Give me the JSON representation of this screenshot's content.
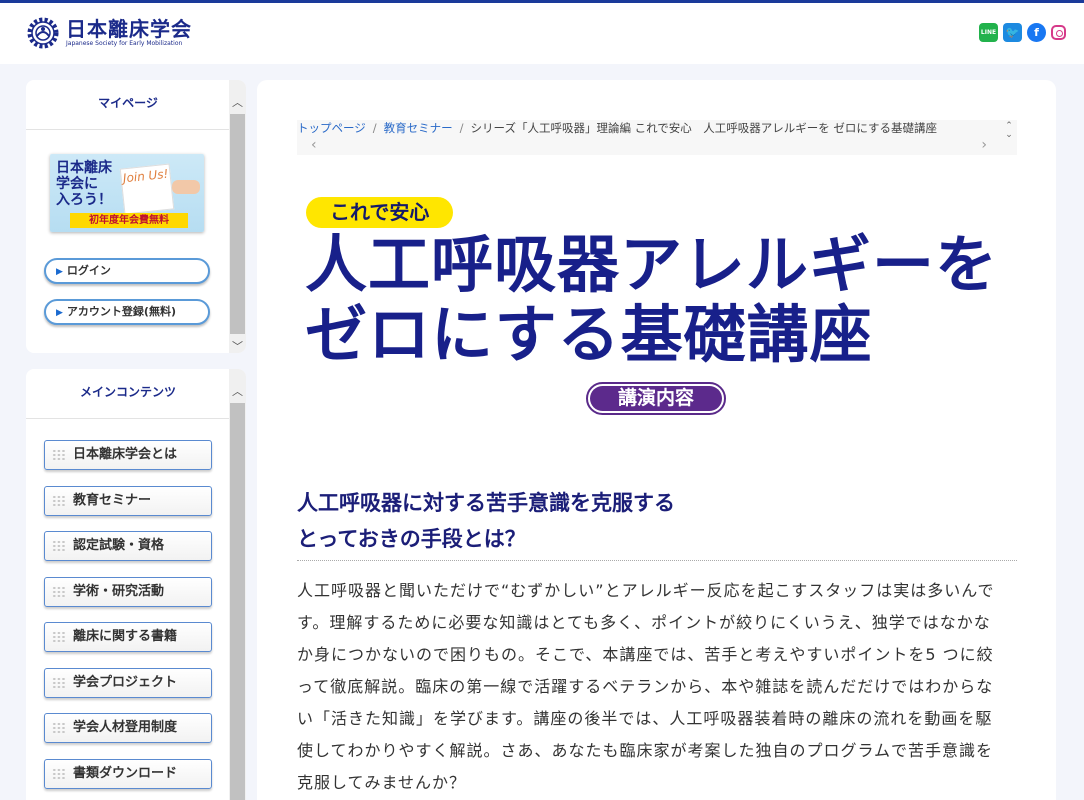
{
  "header": {
    "logo_jp": "日本離床学会",
    "logo_en": "Japanese Society for Early Mobilization",
    "social": {
      "line_label": "LINE",
      "twitter_glyph": "🐦",
      "facebook_glyph": "f"
    }
  },
  "sidebar": {
    "mypage": {
      "title": "マイページ",
      "banner_text": "日本離床\n学会に\n入ろう！",
      "banner_card": "Join Us!",
      "banner_note": "初年度年会費無料",
      "login_label": "ログイン",
      "register_label": "アカウント登録(無料)"
    },
    "main_contents": {
      "title": "メインコンテンツ",
      "items": [
        {
          "label": "日本離床学会とは"
        },
        {
          "label": "教育セミナー"
        },
        {
          "label": "認定試験・資格"
        },
        {
          "label": "学術・研究活動"
        },
        {
          "label": "離床に関する書籍"
        },
        {
          "label": "学会プロジェクト"
        },
        {
          "label": "学会人材登用制度"
        },
        {
          "label": "書類ダウンロード"
        }
      ]
    }
  },
  "breadcrumb": {
    "home": "トップページ",
    "section": "教育セミナー",
    "current": "シリーズ「人工呼吸器」理論編 これで安心　人工呼吸器アレルギーを ゼロにする基礎講座"
  },
  "hero": {
    "tagline": "これで安心",
    "title_line1": "人工呼吸器アレルギーを",
    "title_line2": "ゼロにする基礎講座",
    "badge": "講演内容"
  },
  "content": {
    "heading": "人工呼吸器に対する苦手意識を克服する\nとっておきの手段とは？",
    "body": "人工呼吸器と聞いただけで“むずかしい”とアレルギー反応を起こすスタッフは実は多いんです。理解するために必要な知識はとても多く、ポイントが絞りにくいうえ、独学ではなかなか身につかないので困りもの。そこで、本講座では、苦手と考えやすいポイントを5 つに絞って徹底解説。臨床の第一線で活躍するベテランから、本や雑誌を読んだだけではわからない「活きた知識」を学びます。講座の後半では、人工呼吸器装着時の離床の流れを動画を駆使してわかりやすく解説。さあ、あなたも臨床家が考案した独自のプログラムで苦手意識を克服してみませんか？"
  },
  "colors": {
    "brand_navy": "#1b2a8a",
    "hero_blue": "#18208a",
    "tagline_yellow": "#ffe600",
    "badge_purple": "#5c2a8c",
    "link_blue": "#2a6ac8"
  }
}
